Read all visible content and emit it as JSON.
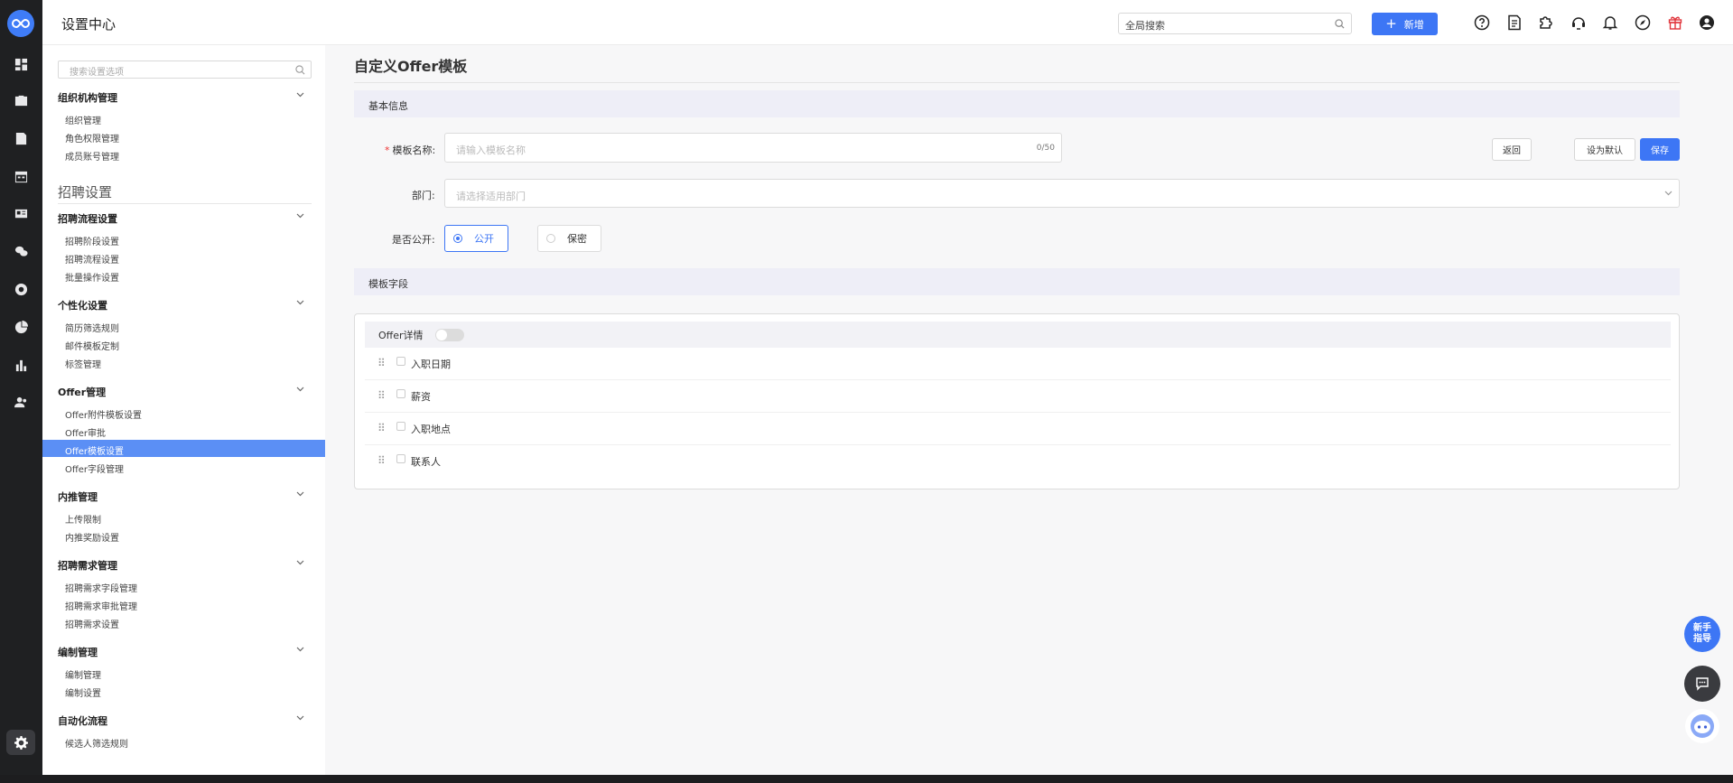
{
  "app": {
    "title": "设置中心"
  },
  "topbar": {
    "search_placeholder": "全局搜索",
    "new_label": "新增",
    "icons": [
      "help-icon",
      "document-icon",
      "plugin-icon",
      "headset-icon",
      "bell-icon",
      "compass-icon",
      "gift-icon",
      "user-icon"
    ]
  },
  "rail": {
    "icons": [
      "dashboard-icon",
      "briefcase-icon",
      "resume-icon",
      "calendar-icon",
      "id-card-icon",
      "wechat-icon",
      "target-icon",
      "pie-chart-icon",
      "bar-chart-icon",
      "people-icon",
      "settings-icon"
    ]
  },
  "sidebar": {
    "search_placeholder": "搜索设置选项",
    "section_title": "招聘设置",
    "groups": [
      {
        "title": "组织机构管理",
        "items": [
          "组织管理",
          "角色权限管理",
          "成员账号管理"
        ]
      },
      {
        "title": "招聘流程设置",
        "items": [
          "招聘阶段设置",
          "招聘流程设置",
          "批量操作设置"
        ]
      },
      {
        "title": "个性化设置",
        "items": [
          "简历筛选规则",
          "邮件模板定制",
          "标签管理"
        ]
      },
      {
        "title": "Offer管理",
        "items": [
          "Offer附件模板设置",
          "Offer审批",
          "Offer模板设置",
          "Offer字段管理"
        ]
      },
      {
        "title": "内推管理",
        "items": [
          "上传限制",
          "内推奖励设置"
        ]
      },
      {
        "title": "招聘需求管理",
        "items": [
          "招聘需求字段管理",
          "招聘需求审批管理",
          "招聘需求设置"
        ]
      },
      {
        "title": "编制管理",
        "items": [
          "编制管理",
          "编制设置"
        ]
      },
      {
        "title": "自动化流程",
        "items": [
          "候选人筛选规则"
        ]
      }
    ],
    "active_item": "Offer模板设置"
  },
  "main": {
    "page_title": "自定义Offer模板",
    "basic_section": "基本信息",
    "name_label": "模板名称:",
    "name_placeholder": "请输入模板名称",
    "name_counter": "0/50",
    "dept_label": "部门:",
    "dept_placeholder": "请选择适用部门",
    "public_label": "是否公开:",
    "radio_public": "公开",
    "radio_private": "保密",
    "selected_visibility": "公开",
    "buttons": {
      "back": "返回",
      "set_default": "设为默认",
      "save": "保存"
    },
    "fields_section": "模板字段",
    "fields_group": "Offer详情",
    "fields_toggle_on": false,
    "fields": [
      "入职日期",
      "薪资",
      "入职地点",
      "联系人"
    ]
  },
  "floating": {
    "guide_line1": "新手",
    "guide_line2": "指导"
  },
  "colors": {
    "accent": "#3d76f5",
    "rail_bg": "#1f2022",
    "active_row": "#5b8ff5"
  }
}
